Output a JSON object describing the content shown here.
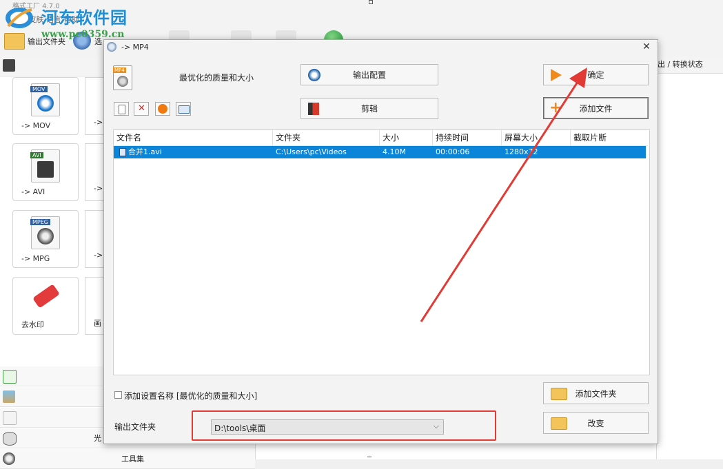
{
  "app": {
    "title": "格式工厂 4.7.0",
    "menu": "任务  皮肤  语言  帮助",
    "toolbar_output_folder": "输出文件夹",
    "toolbar_partial": "选",
    "status_header": "出 / 转换状态"
  },
  "watermark": {
    "name": "河东软件园",
    "url": "www.pc0359.cn"
  },
  "left_panel": {
    "tiles": [
      {
        "label": "-> MOV",
        "tag": "MOV"
      },
      {
        "label": "-> AVI",
        "tag": "AVI"
      },
      {
        "label": "-> MPG",
        "tag": "MPEG"
      },
      {
        "label": "去水印",
        "tag": ""
      }
    ],
    "partial_tiles": [
      "->",
      "->",
      "->",
      "画"
    ],
    "categories": [
      {
        "icon": "music-icon",
        "label": ""
      },
      {
        "icon": "picture-icon",
        "label": ""
      },
      {
        "icon": "document-icon",
        "label": ""
      },
      {
        "icon": "disc-drive-icon",
        "label": "光"
      },
      {
        "icon": "toolbox-icon",
        "label": "工具集"
      }
    ]
  },
  "dialog": {
    "title": "-> MP4",
    "profile_tag": "MP4",
    "profile_text": "最优化的质量和大小",
    "buttons": {
      "output_config": "输出配置",
      "confirm": "确定",
      "clip": "剪辑",
      "add_file": "添加文件",
      "add_folder": "添加文件夹",
      "change": "改变"
    },
    "table": {
      "columns": [
        "文件名",
        "文件夹",
        "大小",
        "持续时间",
        "屏幕大小",
        "截取片断"
      ],
      "rows": [
        {
          "name": "合并1.avi",
          "folder": "C:\\Users\\pc\\Videos",
          "size": "4.10M",
          "duration": "00:00:06",
          "screen": "1280x720",
          "clip": ""
        }
      ]
    },
    "add_setting_label": "添加设置名称 [最优化的质量和大小]",
    "add_setting_checked": false,
    "output_folder_label": "输出文件夹",
    "output_folder_value": "D:\\tools\\桌面"
  },
  "colors": {
    "selection": "#0b85d9",
    "annotation": "#e23a35",
    "watermark": "#1e8fd6"
  }
}
